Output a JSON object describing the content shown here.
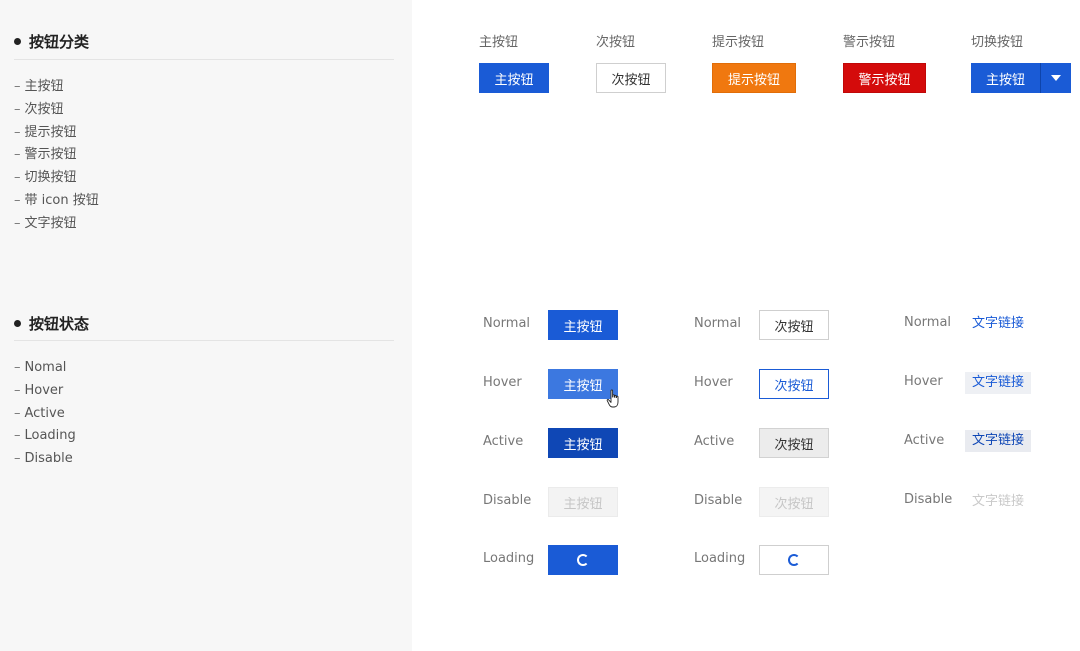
{
  "sidebar": {
    "section1": {
      "title": "按钮分类",
      "items": [
        "主按钮",
        "次按钮",
        "提示按钮",
        "警示按钮",
        "切换按钮",
        "带 icon 按钮",
        "文字按钮"
      ]
    },
    "section2": {
      "title": "按钮状态",
      "items": [
        "Nomal",
        "Hover",
        "Active",
        "Loading",
        "Disable"
      ]
    },
    "dash": "–"
  },
  "types": {
    "columns": [
      {
        "label": "主按钮",
        "button": "主按钮"
      },
      {
        "label": "次按钮",
        "button": "次按钮"
      },
      {
        "label": "提示按钮",
        "button": "提示按钮"
      },
      {
        "label": "警示按钮",
        "button": "警示按钮"
      },
      {
        "label": "切换按钮",
        "button": "主按钮"
      }
    ]
  },
  "states": {
    "labels": [
      "Normal",
      "Hover",
      "Active",
      "Disable",
      "Loading"
    ],
    "primary_text": "主按钮",
    "secondary_text": "次按钮",
    "link_text": "文字链接"
  },
  "colors": {
    "primary": "#1a5bd6",
    "warning": "#f0780f",
    "danger": "#d40b0b",
    "sidebar_bg": "#f7f7f7"
  },
  "icons": {
    "section_bullet": "dot-icon",
    "dropdown": "caret-down-icon",
    "loading": "spinner-icon",
    "cursor": "hand-pointer-icon"
  }
}
